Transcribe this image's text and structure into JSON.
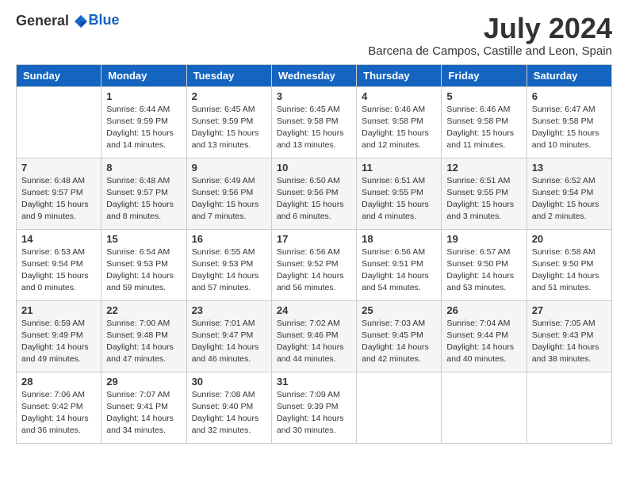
{
  "header": {
    "logo_general": "General",
    "logo_blue": "Blue",
    "month": "July 2024",
    "location": "Barcena de Campos, Castille and Leon, Spain"
  },
  "weekdays": [
    "Sunday",
    "Monday",
    "Tuesday",
    "Wednesday",
    "Thursday",
    "Friday",
    "Saturday"
  ],
  "weeks": [
    [
      {
        "day": "",
        "sunrise": "",
        "sunset": "",
        "daylight": ""
      },
      {
        "day": "1",
        "sunrise": "Sunrise: 6:44 AM",
        "sunset": "Sunset: 9:59 PM",
        "daylight": "Daylight: 15 hours and 14 minutes."
      },
      {
        "day": "2",
        "sunrise": "Sunrise: 6:45 AM",
        "sunset": "Sunset: 9:59 PM",
        "daylight": "Daylight: 15 hours and 13 minutes."
      },
      {
        "day": "3",
        "sunrise": "Sunrise: 6:45 AM",
        "sunset": "Sunset: 9:58 PM",
        "daylight": "Daylight: 15 hours and 13 minutes."
      },
      {
        "day": "4",
        "sunrise": "Sunrise: 6:46 AM",
        "sunset": "Sunset: 9:58 PM",
        "daylight": "Daylight: 15 hours and 12 minutes."
      },
      {
        "day": "5",
        "sunrise": "Sunrise: 6:46 AM",
        "sunset": "Sunset: 9:58 PM",
        "daylight": "Daylight: 15 hours and 11 minutes."
      },
      {
        "day": "6",
        "sunrise": "Sunrise: 6:47 AM",
        "sunset": "Sunset: 9:58 PM",
        "daylight": "Daylight: 15 hours and 10 minutes."
      }
    ],
    [
      {
        "day": "7",
        "sunrise": "Sunrise: 6:48 AM",
        "sunset": "Sunset: 9:57 PM",
        "daylight": "Daylight: 15 hours and 9 minutes."
      },
      {
        "day": "8",
        "sunrise": "Sunrise: 6:48 AM",
        "sunset": "Sunset: 9:57 PM",
        "daylight": "Daylight: 15 hours and 8 minutes."
      },
      {
        "day": "9",
        "sunrise": "Sunrise: 6:49 AM",
        "sunset": "Sunset: 9:56 PM",
        "daylight": "Daylight: 15 hours and 7 minutes."
      },
      {
        "day": "10",
        "sunrise": "Sunrise: 6:50 AM",
        "sunset": "Sunset: 9:56 PM",
        "daylight": "Daylight: 15 hours and 6 minutes."
      },
      {
        "day": "11",
        "sunrise": "Sunrise: 6:51 AM",
        "sunset": "Sunset: 9:55 PM",
        "daylight": "Daylight: 15 hours and 4 minutes."
      },
      {
        "day": "12",
        "sunrise": "Sunrise: 6:51 AM",
        "sunset": "Sunset: 9:55 PM",
        "daylight": "Daylight: 15 hours and 3 minutes."
      },
      {
        "day": "13",
        "sunrise": "Sunrise: 6:52 AM",
        "sunset": "Sunset: 9:54 PM",
        "daylight": "Daylight: 15 hours and 2 minutes."
      }
    ],
    [
      {
        "day": "14",
        "sunrise": "Sunrise: 6:53 AM",
        "sunset": "Sunset: 9:54 PM",
        "daylight": "Daylight: 15 hours and 0 minutes."
      },
      {
        "day": "15",
        "sunrise": "Sunrise: 6:54 AM",
        "sunset": "Sunset: 9:53 PM",
        "daylight": "Daylight: 14 hours and 59 minutes."
      },
      {
        "day": "16",
        "sunrise": "Sunrise: 6:55 AM",
        "sunset": "Sunset: 9:53 PM",
        "daylight": "Daylight: 14 hours and 57 minutes."
      },
      {
        "day": "17",
        "sunrise": "Sunrise: 6:56 AM",
        "sunset": "Sunset: 9:52 PM",
        "daylight": "Daylight: 14 hours and 56 minutes."
      },
      {
        "day": "18",
        "sunrise": "Sunrise: 6:56 AM",
        "sunset": "Sunset: 9:51 PM",
        "daylight": "Daylight: 14 hours and 54 minutes."
      },
      {
        "day": "19",
        "sunrise": "Sunrise: 6:57 AM",
        "sunset": "Sunset: 9:50 PM",
        "daylight": "Daylight: 14 hours and 53 minutes."
      },
      {
        "day": "20",
        "sunrise": "Sunrise: 6:58 AM",
        "sunset": "Sunset: 9:50 PM",
        "daylight": "Daylight: 14 hours and 51 minutes."
      }
    ],
    [
      {
        "day": "21",
        "sunrise": "Sunrise: 6:59 AM",
        "sunset": "Sunset: 9:49 PM",
        "daylight": "Daylight: 14 hours and 49 minutes."
      },
      {
        "day": "22",
        "sunrise": "Sunrise: 7:00 AM",
        "sunset": "Sunset: 9:48 PM",
        "daylight": "Daylight: 14 hours and 47 minutes."
      },
      {
        "day": "23",
        "sunrise": "Sunrise: 7:01 AM",
        "sunset": "Sunset: 9:47 PM",
        "daylight": "Daylight: 14 hours and 46 minutes."
      },
      {
        "day": "24",
        "sunrise": "Sunrise: 7:02 AM",
        "sunset": "Sunset: 9:46 PM",
        "daylight": "Daylight: 14 hours and 44 minutes."
      },
      {
        "day": "25",
        "sunrise": "Sunrise: 7:03 AM",
        "sunset": "Sunset: 9:45 PM",
        "daylight": "Daylight: 14 hours and 42 minutes."
      },
      {
        "day": "26",
        "sunrise": "Sunrise: 7:04 AM",
        "sunset": "Sunset: 9:44 PM",
        "daylight": "Daylight: 14 hours and 40 minutes."
      },
      {
        "day": "27",
        "sunrise": "Sunrise: 7:05 AM",
        "sunset": "Sunset: 9:43 PM",
        "daylight": "Daylight: 14 hours and 38 minutes."
      }
    ],
    [
      {
        "day": "28",
        "sunrise": "Sunrise: 7:06 AM",
        "sunset": "Sunset: 9:42 PM",
        "daylight": "Daylight: 14 hours and 36 minutes."
      },
      {
        "day": "29",
        "sunrise": "Sunrise: 7:07 AM",
        "sunset": "Sunset: 9:41 PM",
        "daylight": "Daylight: 14 hours and 34 minutes."
      },
      {
        "day": "30",
        "sunrise": "Sunrise: 7:08 AM",
        "sunset": "Sunset: 9:40 PM",
        "daylight": "Daylight: 14 hours and 32 minutes."
      },
      {
        "day": "31",
        "sunrise": "Sunrise: 7:09 AM",
        "sunset": "Sunset: 9:39 PM",
        "daylight": "Daylight: 14 hours and 30 minutes."
      },
      {
        "day": "",
        "sunrise": "",
        "sunset": "",
        "daylight": ""
      },
      {
        "day": "",
        "sunrise": "",
        "sunset": "",
        "daylight": ""
      },
      {
        "day": "",
        "sunrise": "",
        "sunset": "",
        "daylight": ""
      }
    ]
  ]
}
